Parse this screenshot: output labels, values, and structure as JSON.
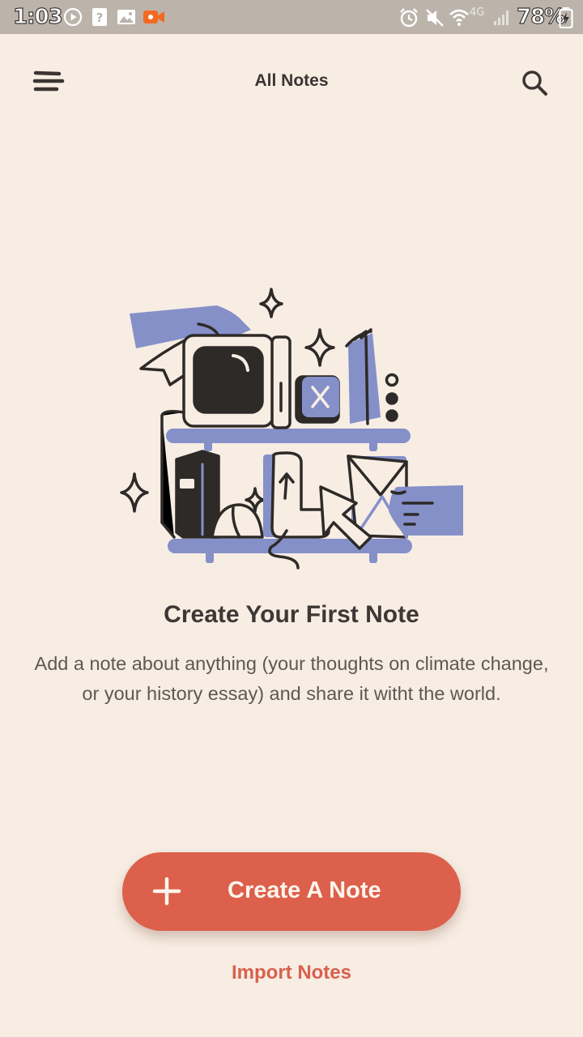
{
  "status_bar": {
    "time": "1:03",
    "network": "4G",
    "battery": "78%",
    "icons": [
      "play-circle-icon",
      "help-icon",
      "image-icon",
      "video-camera-icon",
      "alarm-icon",
      "mute-icon",
      "wifi-icon",
      "signal-icon",
      "battery-icon"
    ]
  },
  "header": {
    "title": "All Notes",
    "menu_icon": "menu-icon",
    "search_icon": "search-icon"
  },
  "empty_state": {
    "illustration": "shelves-illustration",
    "title": "Create Your First Note",
    "description": "Add a note about anything (your thoughts on climate change, or your history essay) and share it witht the world."
  },
  "actions": {
    "create_label": "Create A Note",
    "create_icon": "plus-icon",
    "import_label": "Import Notes"
  },
  "colors": {
    "background": "#f7ede3",
    "status_bar": "#bcb4ab",
    "accent": "#dc604b",
    "illustration_purple": "#8590c9",
    "text_dark": "#3d3835",
    "text_muted": "#5e5853"
  }
}
